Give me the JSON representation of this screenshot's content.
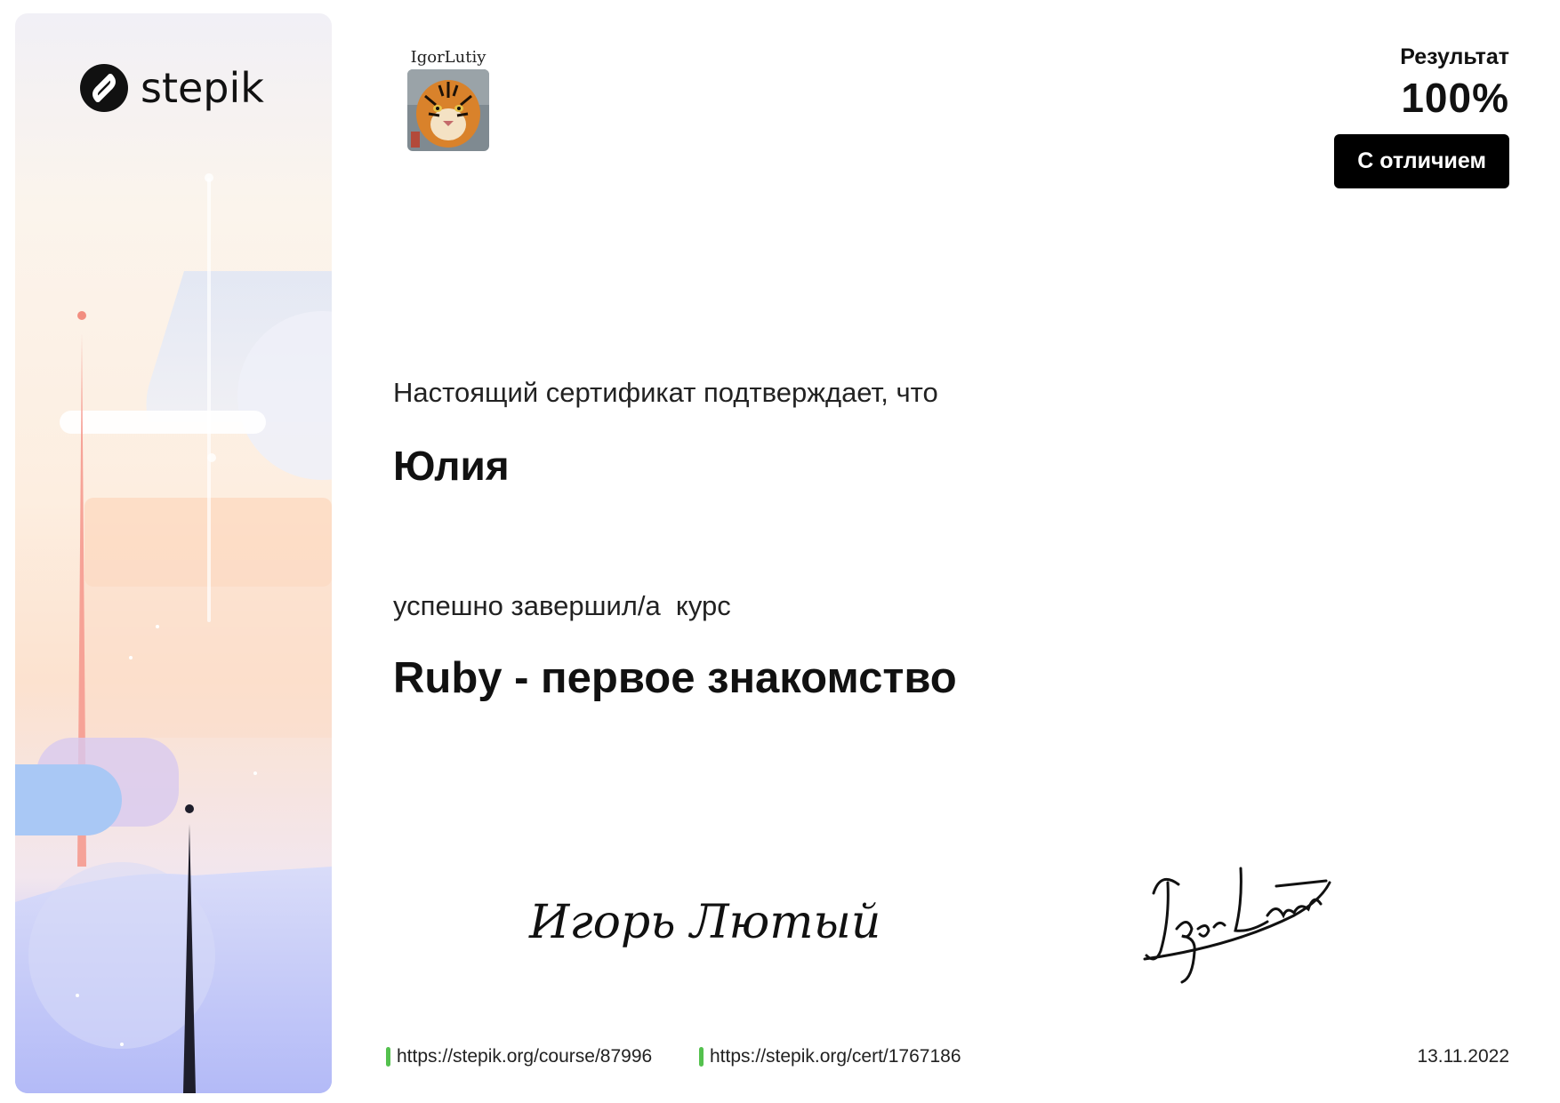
{
  "brand": {
    "name": "stepik",
    "logo_icon": "stepik-logo-icon"
  },
  "author": {
    "label": "IgorLutiy",
    "avatar_icon": "tiger-avatar-icon",
    "display_name": "Игорь Лютый",
    "signature_icon": "handwritten-signature-icon"
  },
  "result": {
    "label": "Результат",
    "value": "100%",
    "honors": "С отличием"
  },
  "certificate": {
    "intro": "Настоящий сертификат подтверждает, что",
    "student_name": "Юлия",
    "completed_text": "успешно завершил/а  курс",
    "course_title": "Ruby - первое знакомство"
  },
  "footer": {
    "course_url": "https://stepik.org/course/87996",
    "cert_url": "https://stepik.org/cert/1767186",
    "date": "13.11.2022",
    "accent_color": "#54c14e"
  }
}
